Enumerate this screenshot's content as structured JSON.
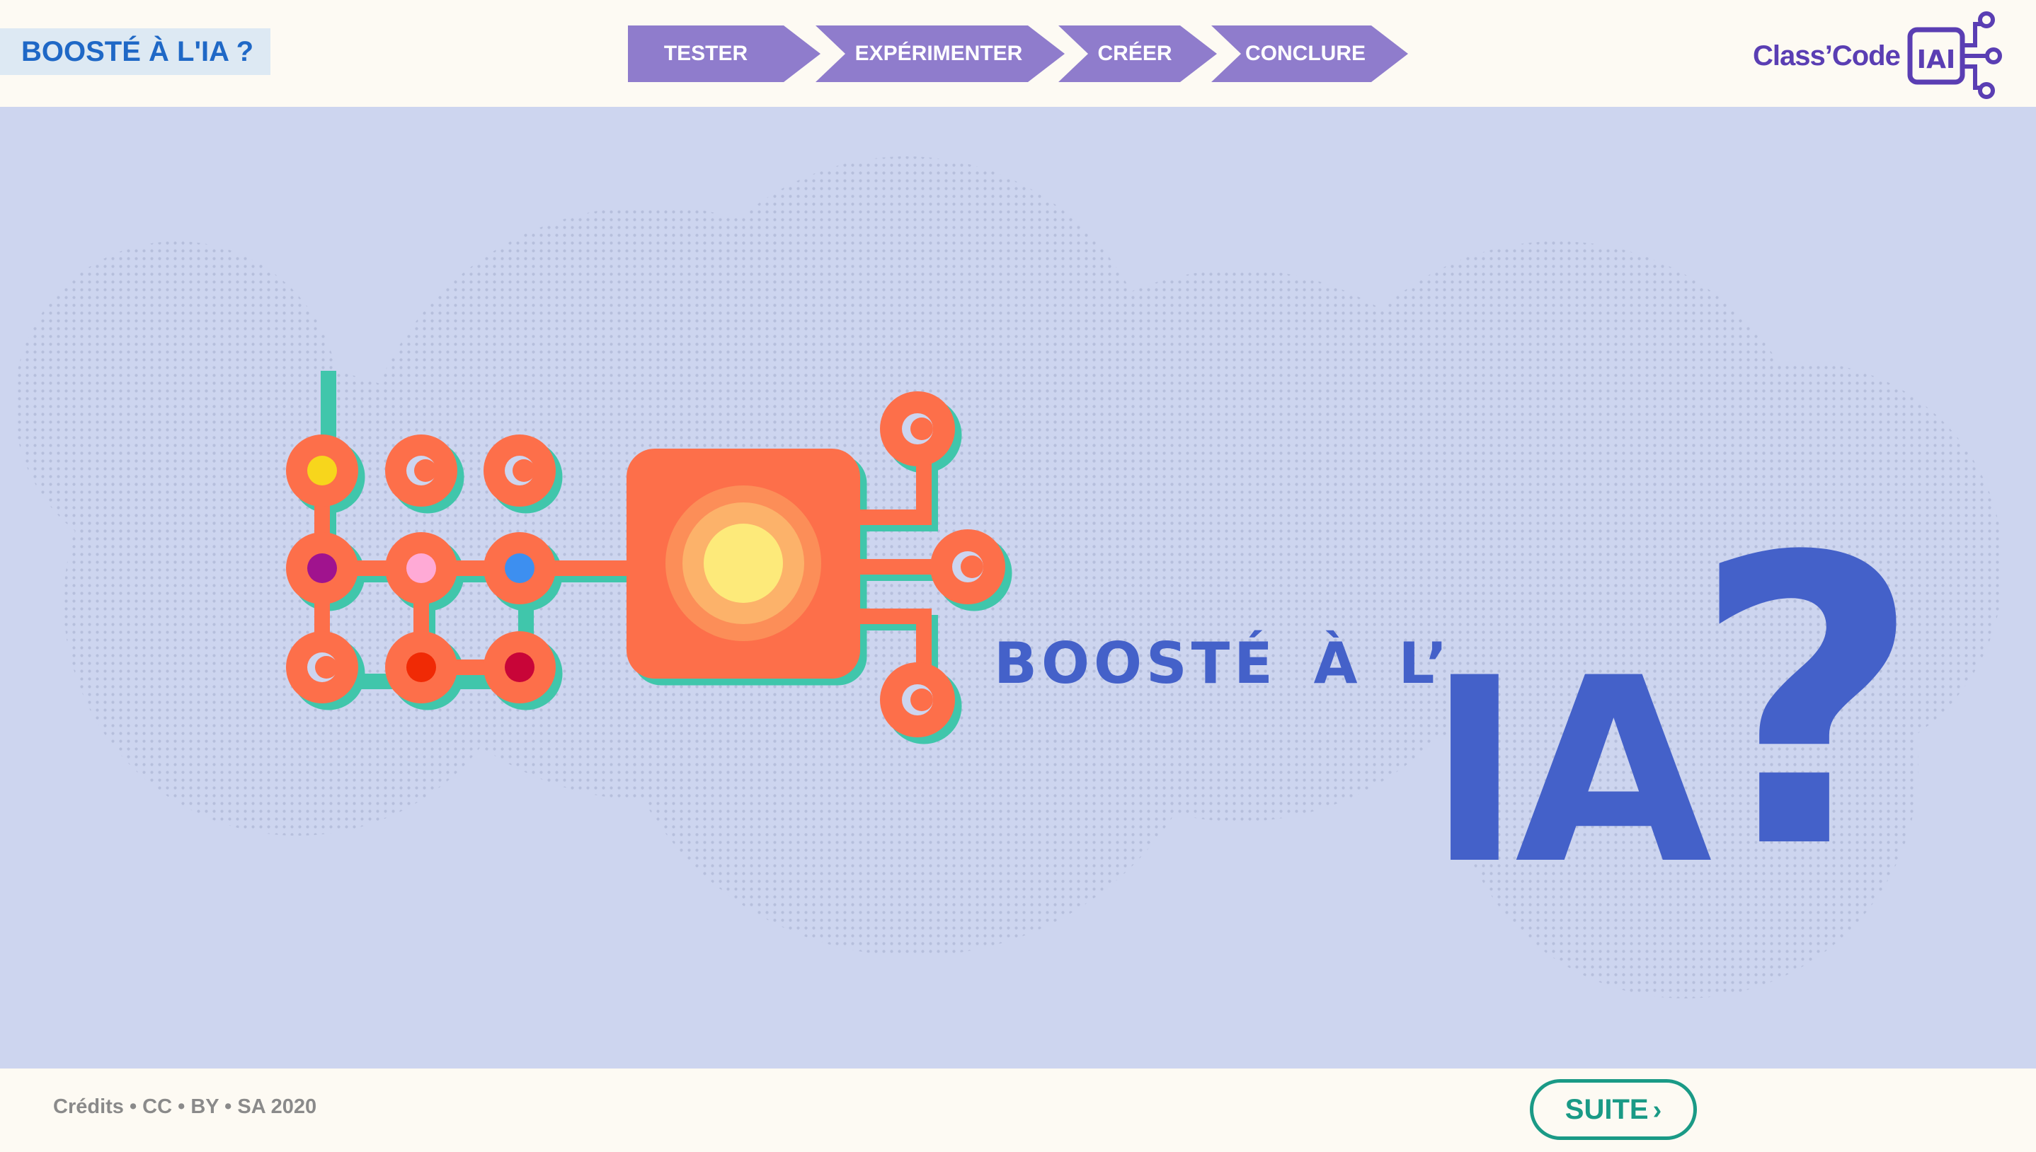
{
  "header": {
    "title_badge": "BOOSTÉ À L'IA ?",
    "steps": [
      {
        "label": "TESTER"
      },
      {
        "label": "EXPÉRIMENTER"
      },
      {
        "label": "CRÉER"
      },
      {
        "label": "CONCLURE"
      }
    ],
    "logo_text": "Class’Code",
    "logo_mark": "IAI"
  },
  "main": {
    "heading": "BOOSTÉ À L’",
    "big_text": "IA",
    "question_mark": "?",
    "illustration": "circuit-chip-icon"
  },
  "footer": {
    "credits": "Crédits • CC • BY • SA 2020",
    "next_label": "SUITE",
    "next_icon": "chevron-right-icon"
  },
  "colors": {
    "step_bg": "#8f7ccc",
    "title_blue": "#1f68c6",
    "heading_blue": "#4461c9",
    "stage_bg": "#cdd5ef",
    "circuit_orange": "#fd6f4a",
    "circuit_teal": "#40c6ab",
    "button_teal": "#1a9a86",
    "logo_purple": "#5a3eb3"
  }
}
